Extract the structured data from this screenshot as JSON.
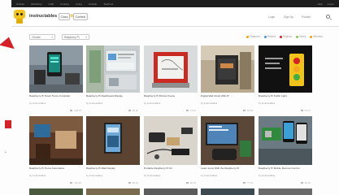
{
  "header": {
    "logo_main": "instructables",
    "logo_sub": "circuits",
    "buttons": [
      "Class",
      "Contest"
    ],
    "links": [
      "Login",
      "Sign Up",
      "Publish"
    ]
  },
  "filter": {
    "category": "Circuits",
    "subcategory": "Raspberry Pi",
    "sort_options": [
      {
        "label": "Featured",
        "color": "#f0a500"
      },
      {
        "label": "Recent",
        "color": "#4a90d9"
      },
      {
        "label": "Popular",
        "color": "#d61f26"
      },
      {
        "label": "Views",
        "color": "#8bc34a"
      },
      {
        "label": "Winners",
        "color": "#ff9800"
      }
    ]
  },
  "cards_row1": [
    {
      "title": "Raspberry Pi Smart Home Controller",
      "author": "by Instructables",
      "stats": "128  45"
    },
    {
      "title": "Raspberry Pi Dashboard Display",
      "author": "by Instructables",
      "stats": "96  30"
    },
    {
      "title": "Raspberry Pi Picture Frame",
      "author": "by Instructables",
      "stats": "74  22"
    },
    {
      "title": "Digital Wall Clock With Pi",
      "author": "by Instructables",
      "stats": "63  18"
    },
    {
      "title": "Raspberry Pi Traffic Light",
      "author": "by Instructables",
      "stats": "81  27"
    }
  ],
  "cards_row2": [
    {
      "title": "Raspberry Pi Home Automation",
      "author": "by Instructables",
      "stats": "112  40"
    },
    {
      "title": "Raspberry Pi Wall Display",
      "author": "by Instructables",
      "stats": "58  16"
    },
    {
      "title": "Portable Raspberry Pi Kit",
      "author": "by Instructables",
      "stats": "90  35"
    },
    {
      "title": "Learn Linux With the Raspberry Pi",
      "author": "by Instructables",
      "stats": "77  21"
    },
    {
      "title": "Raspberry Pi Mobile Remote Control",
      "author": "by Instructables",
      "stats": "69  19"
    }
  ],
  "sysbar": {
    "left_items": [
      "Circuits",
      "Workshop",
      "Craft",
      "Cooking",
      "Living",
      "Outside",
      "Teachers"
    ],
    "right_items": [
      "Help",
      "Log In"
    ]
  }
}
